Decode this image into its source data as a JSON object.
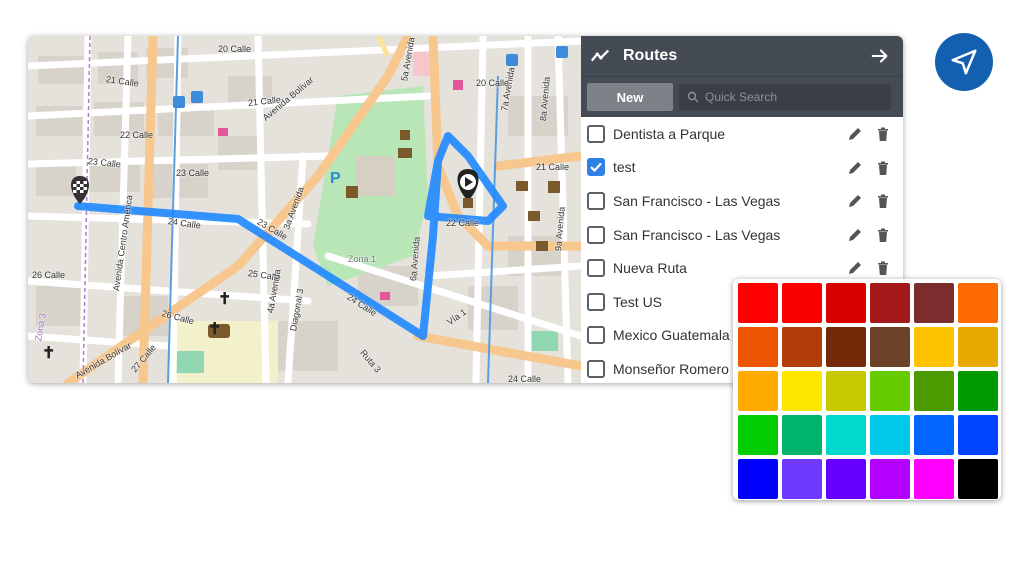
{
  "map": {
    "labels": [
      "20 Calle",
      "21 Calle",
      "21 Calle",
      "22 Calle",
      "23 Calle",
      "23 Calle",
      "24 Calle",
      "24 Calle",
      "23 Calle",
      "25 Calle",
      "26 Calle",
      "26 Calle",
      "27 Calle",
      "Avenida Bolívar",
      "Avenida Bolívar",
      "Avenida Centro América",
      "3a Avenida",
      "4a Avenida",
      "5a Avenida",
      "6a Avenida",
      "7a Avenida",
      "8a Avenida",
      "9a Avenida",
      "Zona 1",
      "Zona 3",
      "Diagonal 3",
      "Ruta 3",
      "Vía 1",
      "20 Calle",
      "21 Calle",
      "22 Calle",
      "24 Calle"
    ]
  },
  "panel": {
    "title": "Routes",
    "new_label": "New",
    "search_placeholder": "Quick Search"
  },
  "routes": [
    {
      "name": "Dentista a Parque",
      "checked": false
    },
    {
      "name": "test",
      "checked": true
    },
    {
      "name": "San Francisco - Las Vegas",
      "checked": false
    },
    {
      "name": "San Francisco - Las Vegas",
      "checked": false
    },
    {
      "name": "Nueva Ruta",
      "checked": false
    },
    {
      "name": "Test US",
      "checked": false
    },
    {
      "name": "Mexico Guatemala",
      "checked": false
    },
    {
      "name": "Monseñor Romero",
      "checked": false
    }
  ],
  "palette": {
    "colors": [
      "#ff0000",
      "#f80000",
      "#d90000",
      "#a31919",
      "#7b2c2c",
      "#ff6a00",
      "#ee5500",
      "#b23c0a",
      "#722a08",
      "#6b4128",
      "#fdc300",
      "#e8a900",
      "#ffaa00",
      "#ffe600",
      "#c8c800",
      "#66cc00",
      "#4a9a00",
      "#009900",
      "#00cc00",
      "#00b46e",
      "#00d9cc",
      "#00c8e8",
      "#0066ff",
      "#0044ff",
      "#0000ff",
      "#6f3aff",
      "#6600ff",
      "#b300ff",
      "#ff00ff",
      "#000000"
    ]
  },
  "accent": "#1e88ff"
}
